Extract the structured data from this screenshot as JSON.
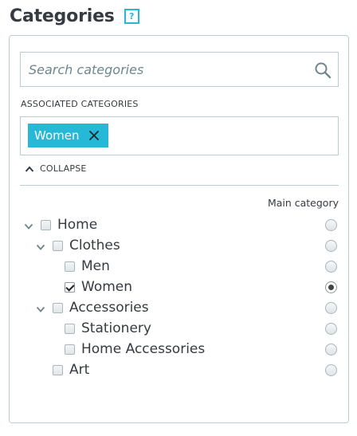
{
  "header": {
    "title": "Categories",
    "help_label": "?"
  },
  "search": {
    "placeholder": "Search categories"
  },
  "associated": {
    "label": "ASSOCIATED CATEGORIES",
    "tags": [
      {
        "label": "Women"
      }
    ]
  },
  "collapse_label": "COLLAPSE",
  "main_category_label": "Main category",
  "tree": [
    {
      "label": "Home",
      "depth": 0,
      "expanded": true,
      "checked": false,
      "main": false
    },
    {
      "label": "Clothes",
      "depth": 1,
      "expanded": true,
      "checked": false,
      "main": false
    },
    {
      "label": "Men",
      "depth": 2,
      "expanded": null,
      "checked": false,
      "main": false
    },
    {
      "label": "Women",
      "depth": 2,
      "expanded": null,
      "checked": true,
      "main": true
    },
    {
      "label": "Accessories",
      "depth": 1,
      "expanded": true,
      "checked": false,
      "main": false
    },
    {
      "label": "Stationery",
      "depth": 2,
      "expanded": null,
      "checked": false,
      "main": false
    },
    {
      "label": "Home Accessories",
      "depth": 2,
      "expanded": null,
      "checked": false,
      "main": false
    },
    {
      "label": "Art",
      "depth": 1,
      "expanded": null,
      "checked": false,
      "main": false
    }
  ],
  "colors": {
    "accent": "#25b9d7",
    "border": "#bbcdd2",
    "text": "#363a41",
    "muted": "#6c868e"
  }
}
